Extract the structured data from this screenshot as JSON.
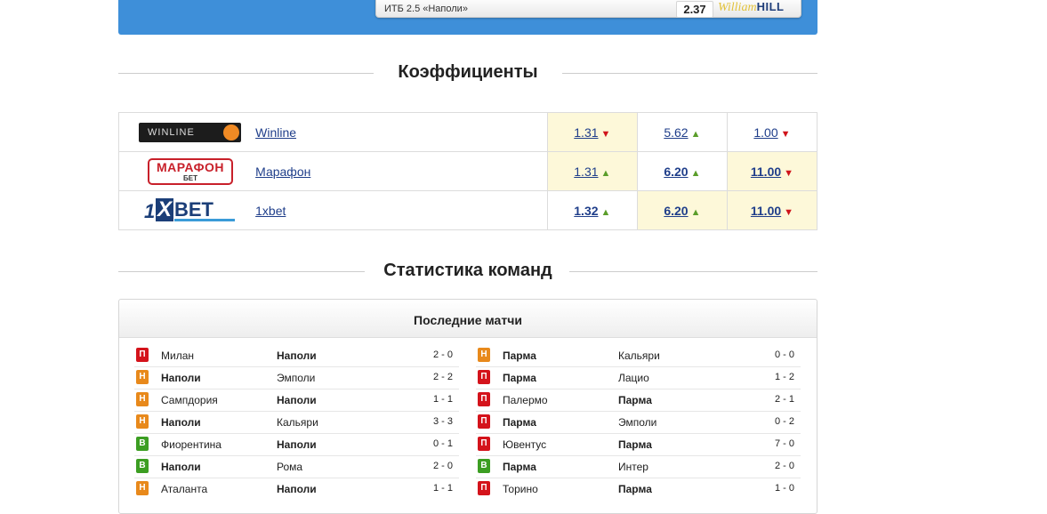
{
  "banner": {
    "bet_label": "ИТБ 2.5 «Наполи»",
    "bet_odd": "2.37",
    "bookmaker_logo": {
      "script": "William",
      "word": "HILL"
    }
  },
  "odds_section": {
    "title": "Коэффициенты",
    "rows": [
      {
        "bookmaker": "Winline",
        "logo": "winline-logo",
        "logo_text": "WINLINE",
        "odds": [
          {
            "value": "1.31",
            "trend": "down",
            "bold": false,
            "highlight": true
          },
          {
            "value": "5.62",
            "trend": "up",
            "bold": false,
            "highlight": false
          },
          {
            "value": "1.00",
            "trend": "down",
            "bold": false,
            "highlight": false
          }
        ]
      },
      {
        "bookmaker": "Марафон",
        "logo": "marathon-logo",
        "logo_text": "МАРАФОН",
        "logo_sub": "БЕТ",
        "odds": [
          {
            "value": "1.31",
            "trend": "up",
            "bold": false,
            "highlight": true
          },
          {
            "value": "6.20",
            "trend": "up",
            "bold": true,
            "highlight": false
          },
          {
            "value": "11.00",
            "trend": "down",
            "bold": true,
            "highlight": true
          }
        ]
      },
      {
        "bookmaker": "1xbet",
        "logo": "1xbet-logo",
        "logo_one": "1",
        "logo_x": "X",
        "logo_bet": "BET",
        "odds": [
          {
            "value": "1.32",
            "trend": "up",
            "bold": true,
            "highlight": false
          },
          {
            "value": "6.20",
            "trend": "up",
            "bold": true,
            "highlight": true
          },
          {
            "value": "11.00",
            "trend": "down",
            "bold": true,
            "highlight": true
          }
        ]
      }
    ]
  },
  "stats_section": {
    "title": "Статистика команд",
    "panel_title": "Последние матчи",
    "left_matches": [
      {
        "result": "П",
        "type": "loss",
        "home": "Милан",
        "away": "Наполи",
        "bold": "away",
        "score": "2 - 0"
      },
      {
        "result": "Н",
        "type": "draw",
        "home": "Наполи",
        "away": "Эмполи",
        "bold": "home",
        "score": "2 - 2"
      },
      {
        "result": "Н",
        "type": "draw",
        "home": "Сампдория",
        "away": "Наполи",
        "bold": "away",
        "score": "1 - 1"
      },
      {
        "result": "Н",
        "type": "draw",
        "home": "Наполи",
        "away": "Кальяри",
        "bold": "home",
        "score": "3 - 3"
      },
      {
        "result": "В",
        "type": "win",
        "home": "Фиорентина",
        "away": "Наполи",
        "bold": "away",
        "score": "0 - 1"
      },
      {
        "result": "В",
        "type": "win",
        "home": "Наполи",
        "away": "Рома",
        "bold": "home",
        "score": "2 - 0"
      },
      {
        "result": "Н",
        "type": "draw",
        "home": "Аталанта",
        "away": "Наполи",
        "bold": "away",
        "score": "1 - 1"
      }
    ],
    "right_matches": [
      {
        "result": "Н",
        "type": "draw",
        "home": "Парма",
        "away": "Кальяри",
        "bold": "home",
        "score": "0 - 0"
      },
      {
        "result": "П",
        "type": "loss",
        "home": "Парма",
        "away": "Лацио",
        "bold": "home",
        "score": "1 - 2"
      },
      {
        "result": "П",
        "type": "loss",
        "home": "Палермо",
        "away": "Парма",
        "bold": "away",
        "score": "2 - 1"
      },
      {
        "result": "П",
        "type": "loss",
        "home": "Парма",
        "away": "Эмполи",
        "bold": "home",
        "score": "0 - 2"
      },
      {
        "result": "П",
        "type": "loss",
        "home": "Ювентус",
        "away": "Парма",
        "bold": "away",
        "score": "7 - 0"
      },
      {
        "result": "В",
        "type": "win",
        "home": "Парма",
        "away": "Интер",
        "bold": "home",
        "score": "2 - 0"
      },
      {
        "result": "П",
        "type": "loss",
        "home": "Торино",
        "away": "Парма",
        "bold": "away",
        "score": "1 - 0"
      }
    ]
  },
  "colors": {
    "banner_blue": "#3e8fd9",
    "highlight_cell": "#fdf8d9",
    "link": "#1f3e8a",
    "trend_up": "#5a9d2a",
    "trend_down": "#d0141b",
    "badge_loss": "#d4131b",
    "badge_draw": "#e8891b",
    "badge_win": "#3c9e22"
  }
}
